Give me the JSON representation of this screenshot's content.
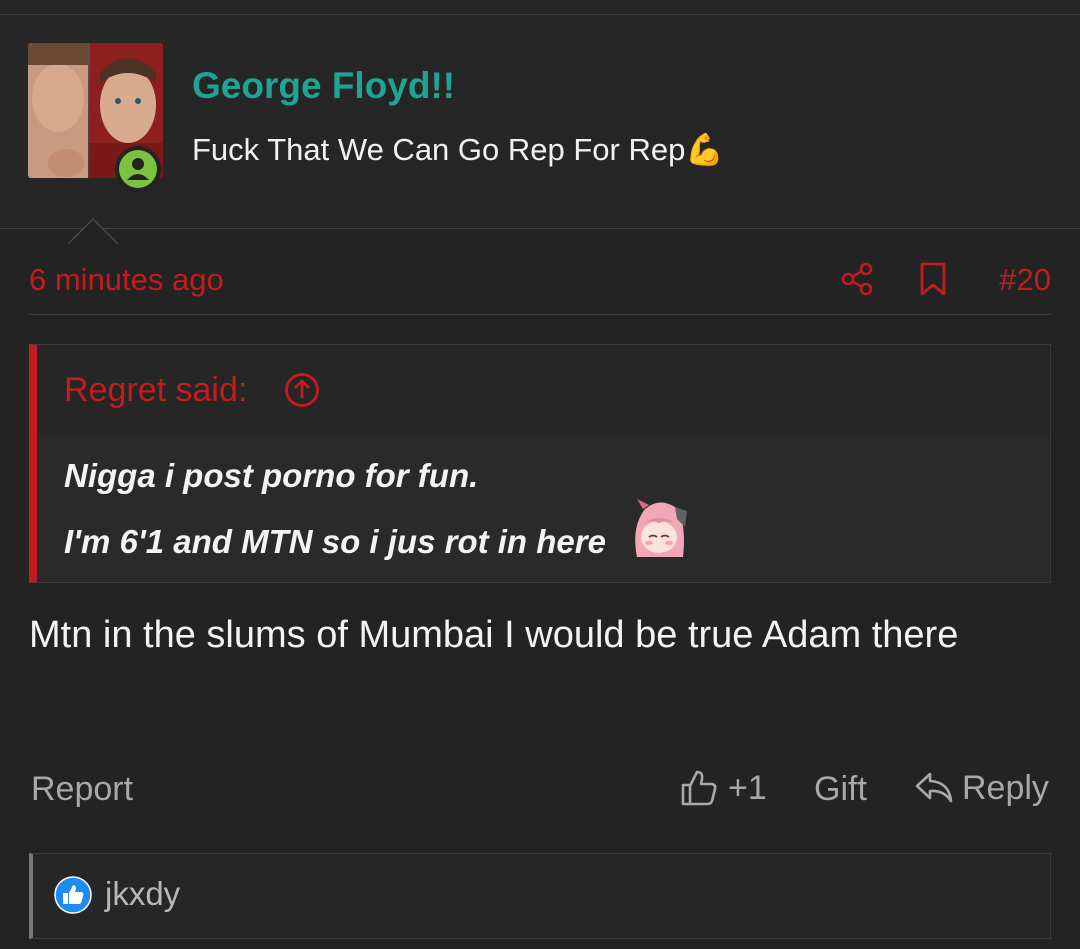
{
  "colors": {
    "background": "#232323",
    "username": "#1fa394",
    "accent_red": "#c21c1c",
    "muted_text": "#a8a8a8",
    "online_badge": "#7cc241",
    "like_badge": "#1d8cf0"
  },
  "user": {
    "name": "George Floyd!!",
    "title": "Fuck That We Can Go Rep For Rep💪",
    "avatar_icon": "avatar-photo",
    "status_icon": "online-user-icon"
  },
  "post": {
    "time": "6 minutes ago",
    "number": "#20",
    "share_icon": "share-icon",
    "bookmark_icon": "bookmark-icon",
    "body": "Mtn in the slums of Mumbai I would be true Adam there"
  },
  "quote": {
    "author_label": "Regret said:",
    "jump_icon": "arrow-up-circle-icon",
    "line1": "Nigga i post porno for fun.",
    "line2": "I'm 6'1 and MTN so i jus rot in here",
    "emoji_icon": "anime-girl-emoji"
  },
  "actions": {
    "report": "Report",
    "like_count": "+1",
    "like_icon": "thumbs-up-icon",
    "gift": "Gift",
    "reply": "Reply",
    "reply_icon": "reply-arrow-icon"
  },
  "reactions": {
    "icon": "like-reaction-icon",
    "users": "jkxdy"
  }
}
